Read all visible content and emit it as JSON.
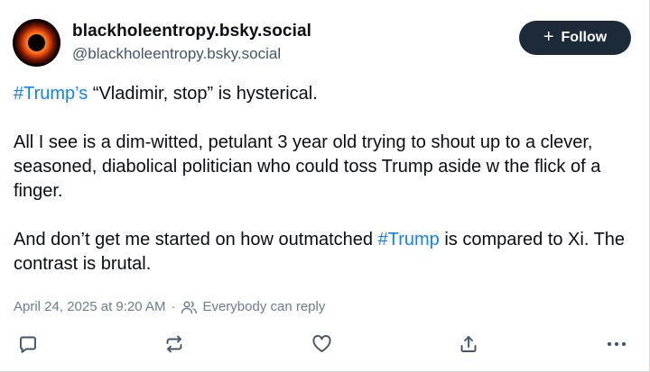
{
  "author": {
    "display_name": "blackholeentropy.bsky.social",
    "handle": "@blackholeentropy.bsky.social"
  },
  "follow_button": {
    "label": "Follow",
    "icon": "plus-icon"
  },
  "post": {
    "paragraph1": {
      "tag": "#Trump’s",
      "text": " “Vladimir, stop” is hysterical."
    },
    "paragraph2": "All I see is a dim-witted, petulant 3 year old trying to shout up to a clever, seasoned, diabolical politician who could toss Trump aside w the flick of a finger.",
    "paragraph3": {
      "before": "And don’t get me started on how outmatched ",
      "tag": "#Trump",
      "after": " is compared to Xi. The contrast is brutal."
    },
    "timestamp": "April 24, 2025 at 9:20 AM",
    "separator": "·",
    "reply_setting": "Everybody can reply"
  },
  "actions": [
    "reply-icon",
    "repost-icon",
    "like-icon",
    "share-icon",
    "more-icon"
  ],
  "colors": {
    "link": "#1083fe",
    "button_bg": "#1d2a39",
    "meta": "#6a7f94"
  }
}
